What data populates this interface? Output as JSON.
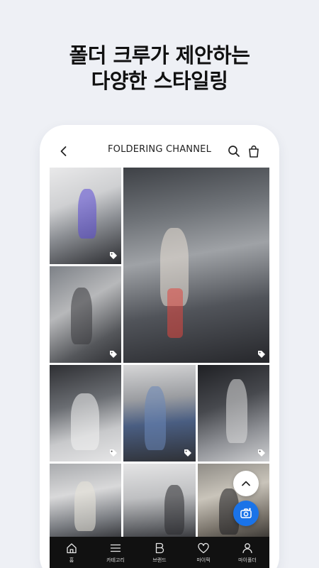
{
  "promo": {
    "line1": "폴더 크루가 제안하는",
    "line2": "다양한 스타일링"
  },
  "appbar": {
    "title": "FOLDERING CHANNEL",
    "icons": [
      "back-arrow-icon",
      "search-icon",
      "shopping-bag-icon"
    ]
  },
  "feed": {
    "tiles": [
      {
        "id": "p1",
        "has_tag": true
      },
      {
        "id": "p2",
        "has_tag": true
      },
      {
        "id": "p3",
        "has_tag": true
      },
      {
        "id": "p4",
        "has_tag": true
      },
      {
        "id": "p5",
        "has_tag": true
      },
      {
        "id": "p6",
        "has_tag": true
      },
      {
        "id": "p7",
        "has_tag": false
      },
      {
        "id": "p8",
        "has_tag": false
      },
      {
        "id": "p9",
        "has_tag": false
      }
    ]
  },
  "fabs": {
    "scroll_top_icon": "chevron-up-icon",
    "camera_icon": "camera-icon",
    "camera_color": "#1a73e8"
  },
  "bottom_nav": {
    "items": [
      {
        "label": "홈",
        "icon": "home-icon"
      },
      {
        "label": "카테고리",
        "icon": "menu-icon"
      },
      {
        "label": "브랜드",
        "icon": "brand-b-icon"
      },
      {
        "label": "마이픽",
        "icon": "heart-icon"
      },
      {
        "label": "마이폴더",
        "icon": "person-icon"
      }
    ],
    "background": "#111111"
  }
}
